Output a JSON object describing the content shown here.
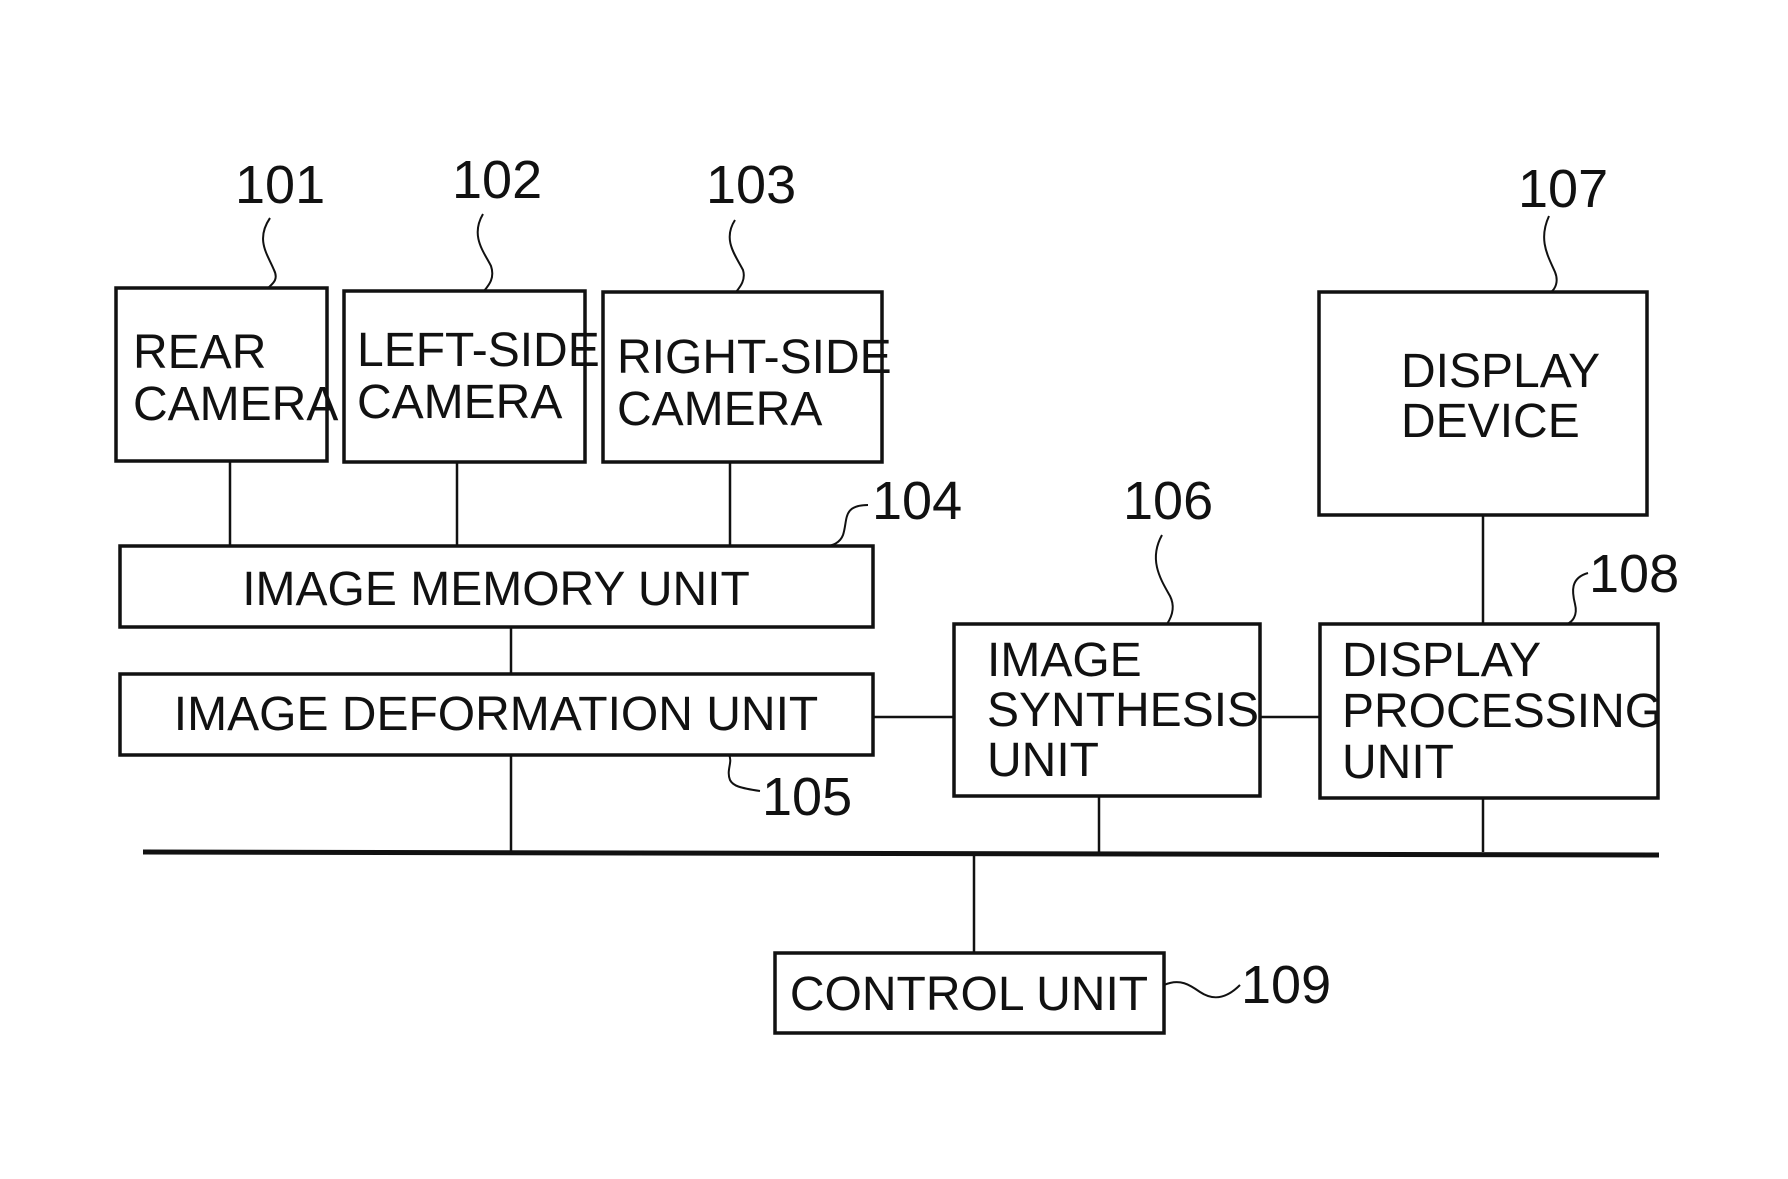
{
  "diagram": {
    "type": "block-diagram",
    "blocks": [
      {
        "id": "101",
        "ref": "101",
        "lines": [
          "REAR",
          "CAMERA"
        ]
      },
      {
        "id": "102",
        "ref": "102",
        "lines": [
          "LEFT-SIDE",
          "CAMERA"
        ]
      },
      {
        "id": "103",
        "ref": "103",
        "lines": [
          "RIGHT-SIDE",
          "CAMERA"
        ]
      },
      {
        "id": "104",
        "ref": "104",
        "lines": [
          "IMAGE MEMORY UNIT"
        ]
      },
      {
        "id": "105",
        "ref": "105",
        "lines": [
          "IMAGE DEFORMATION UNIT"
        ]
      },
      {
        "id": "106",
        "ref": "106",
        "lines": [
          "IMAGE",
          "SYNTHESIS",
          "UNIT"
        ]
      },
      {
        "id": "107",
        "ref": "107",
        "lines": [
          "DISPLAY",
          "DEVICE"
        ]
      },
      {
        "id": "108",
        "ref": "108",
        "lines": [
          "DISPLAY",
          "PROCESSING",
          "UNIT"
        ]
      },
      {
        "id": "109",
        "ref": "109",
        "lines": [
          "CONTROL UNIT"
        ]
      }
    ],
    "connections": [
      [
        "101",
        "104"
      ],
      [
        "102",
        "104"
      ],
      [
        "103",
        "104"
      ],
      [
        "104",
        "105"
      ],
      [
        "105",
        "106"
      ],
      [
        "106",
        "108"
      ],
      [
        "107",
        "108"
      ],
      [
        "105",
        "bus"
      ],
      [
        "106",
        "bus"
      ],
      [
        "108",
        "bus"
      ],
      [
        "109",
        "bus"
      ]
    ]
  }
}
